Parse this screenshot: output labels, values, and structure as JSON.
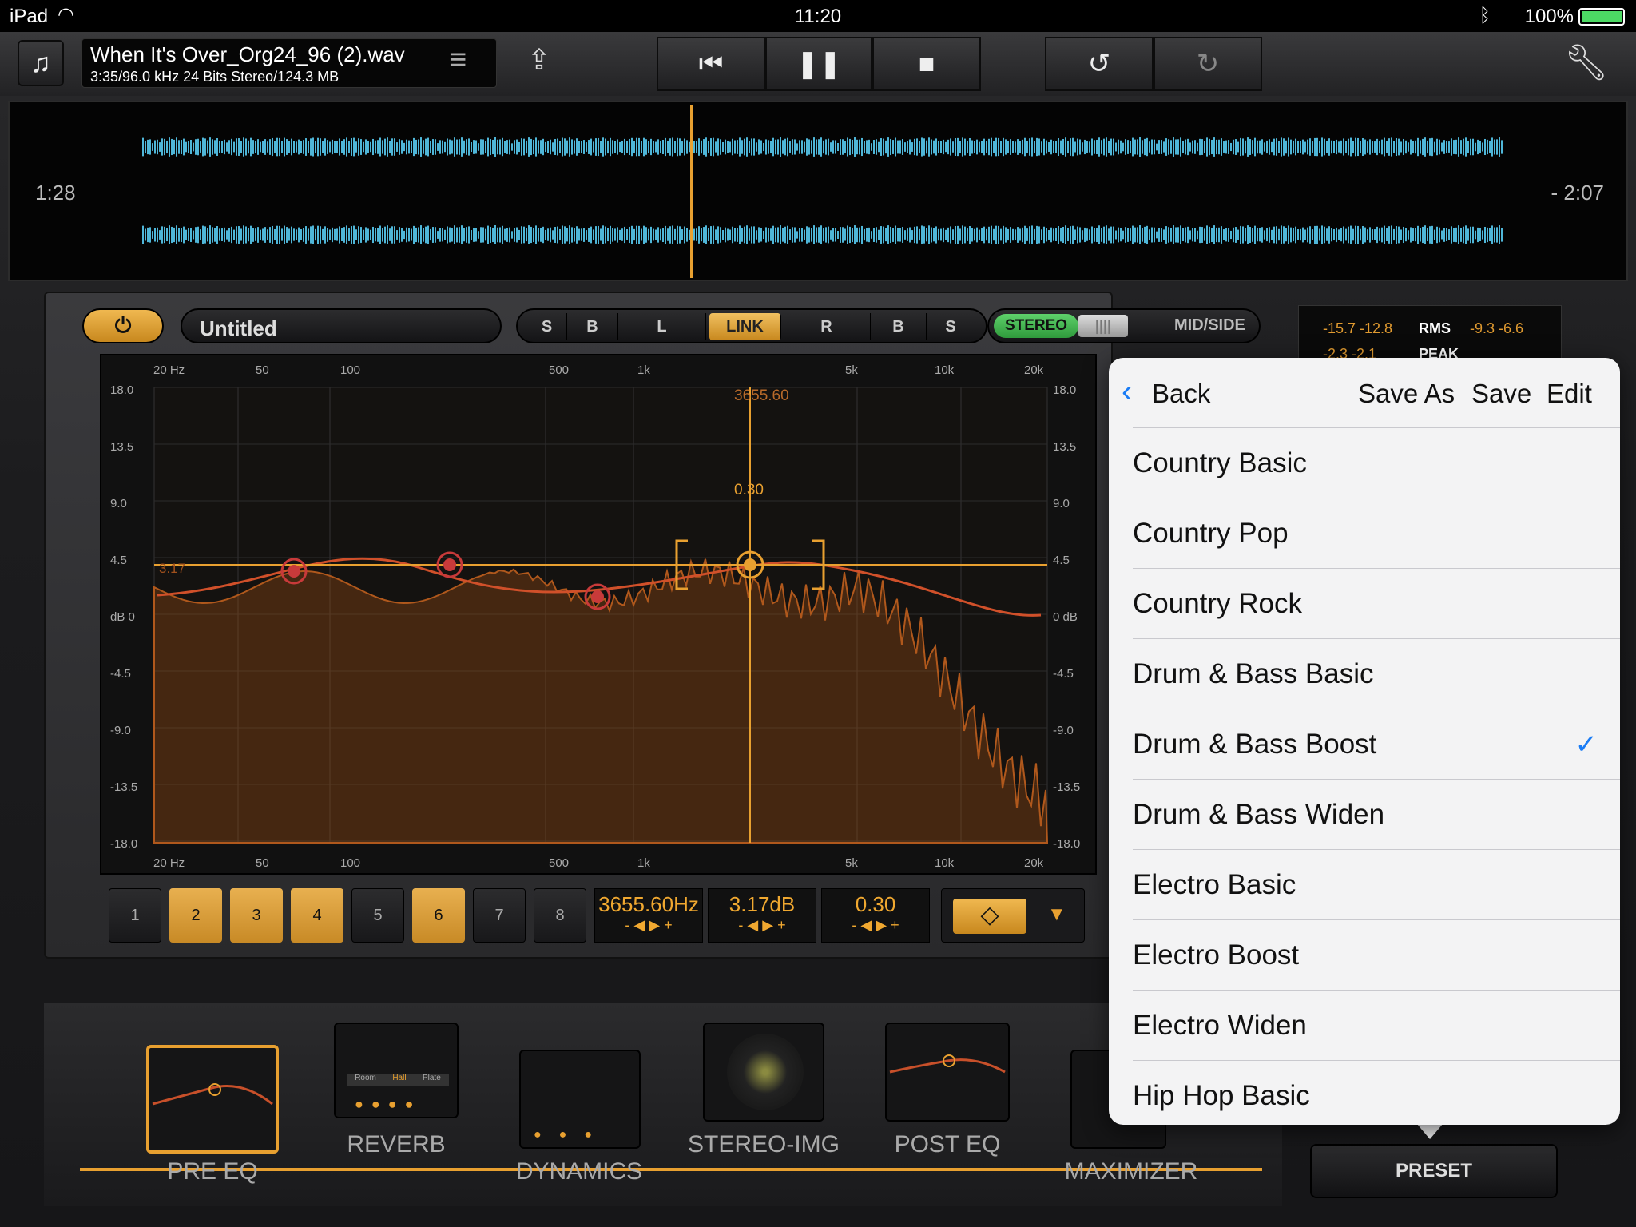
{
  "status_bar": {
    "device": "iPad",
    "time": "11:20",
    "battery": "100%"
  },
  "toolbar": {
    "file_name": "When It's Over_Org24_96 (2).wav",
    "file_details": "3:35/96.0 kHz 24 Bits Stereo/124.3 MB"
  },
  "waveform": {
    "elapsed": "1:28",
    "remaining": "- 2:07"
  },
  "eq": {
    "preset_name": "Untitled",
    "channel_buttons": [
      "S",
      "B",
      "L",
      "LINK",
      "R",
      "B",
      "S"
    ],
    "stereo_label": "STEREO",
    "midside_label": "MID/SIDE",
    "freq_ticks": [
      "20 Hz",
      "50",
      "100",
      "500",
      "1k",
      "5k",
      "10k",
      "20k"
    ],
    "db_ticks_left": [
      "18.0",
      "13.5",
      "9.0",
      "4.5",
      "dB 0",
      "-4.5",
      "-9.0",
      "-13.5",
      "-18.0"
    ],
    "db_ticks_right": [
      "18.0",
      "13.5",
      "9.0",
      "4.5",
      "0 dB",
      "-4.5",
      "-9.0",
      "-13.5",
      "-18.0"
    ],
    "cursor_freq": "3655.60",
    "q_label": "0.30",
    "left_gain_label": "3.17",
    "bands": [
      "1",
      "2",
      "3",
      "4",
      "5",
      "6",
      "7",
      "8"
    ],
    "active_bands": [
      2,
      3,
      4,
      6
    ],
    "frequency_value": "3655.60Hz",
    "gain_value": "3.17dB",
    "q_value": "0.30",
    "stepper_arrows": "- ◀ ▶ +"
  },
  "meter": {
    "row1": "-15.7 -12.8",
    "rms_label": "RMS",
    "row1_right": "-9.3 -6.6",
    "row2": "-2.3 -2.1",
    "peak_label": "PEAK"
  },
  "modules": [
    {
      "label": "PRE EQ"
    },
    {
      "label": "REVERB"
    },
    {
      "label": "DYNAMICS"
    },
    {
      "label": "STEREO-IMG"
    },
    {
      "label": "POST EQ"
    },
    {
      "label": "MAXIMIZER"
    }
  ],
  "reverb_tabs": [
    "Room",
    "Hall",
    "Plate"
  ],
  "preset_button": "PRESET",
  "preset_menu": {
    "back": "Back",
    "save_as": "Save As",
    "save": "Save",
    "edit": "Edit",
    "items": [
      "Country Basic",
      "Country Pop",
      "Country Rock",
      "Drum & Bass Basic",
      "Drum & Bass Boost",
      "Drum & Bass Widen",
      "Electro Basic",
      "Electro Boost",
      "Electro Widen",
      "Hip Hop Basic"
    ],
    "selected": "Drum & Bass Boost",
    "accent": "#1a7cf5"
  },
  "colors": {
    "accent_orange": "#e8a030",
    "curve": "#c8502a",
    "wave": "#4fb6d8",
    "stereo_green": "#3fb04a"
  }
}
